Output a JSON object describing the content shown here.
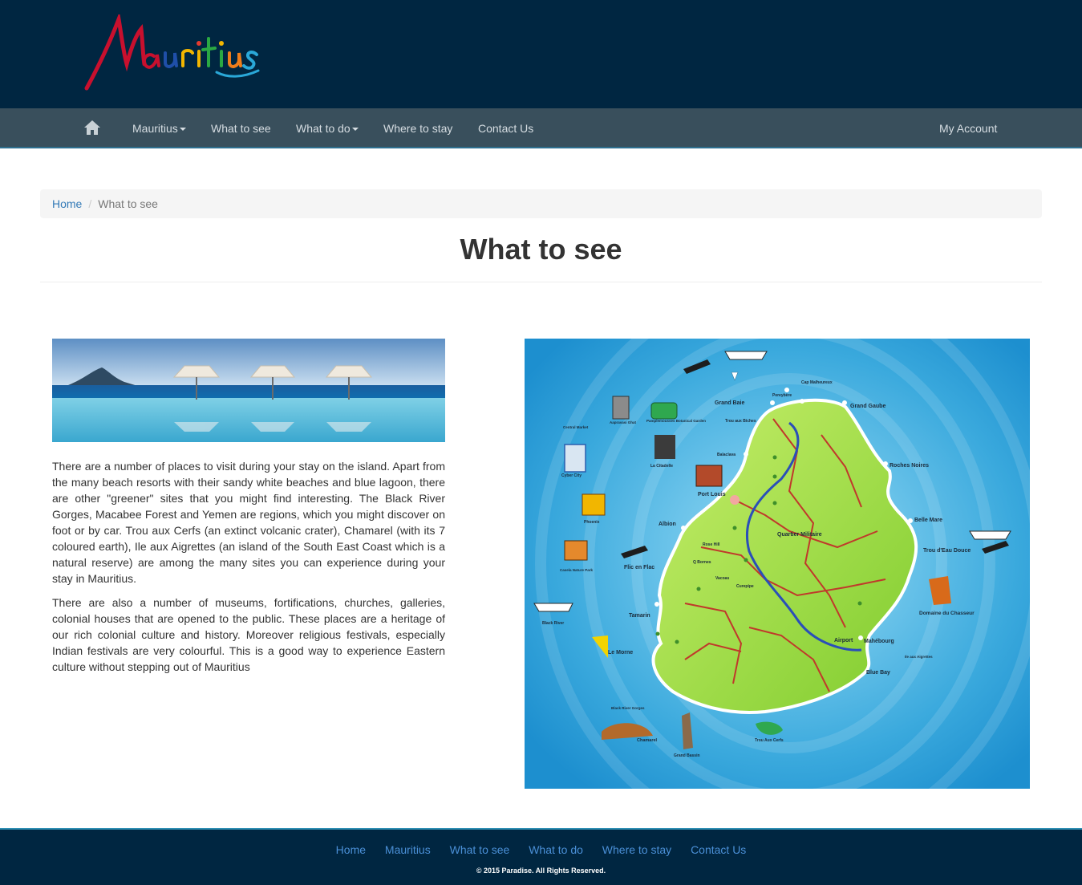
{
  "header": {
    "logo_text": "Mauritius"
  },
  "nav": {
    "home_icon": "home-icon",
    "items": [
      {
        "label": "Mauritius",
        "dropdown": true
      },
      {
        "label": "What to see",
        "dropdown": false
      },
      {
        "label": "What to do",
        "dropdown": true
      },
      {
        "label": "Where to stay",
        "dropdown": false
      },
      {
        "label": "Contact Us",
        "dropdown": false
      }
    ],
    "account": "My Account"
  },
  "breadcrumb": {
    "home": "Home",
    "separator": "/",
    "current": "What to see"
  },
  "page": {
    "title": "What to see",
    "paragraphs": [
      "There are a number of places to visit during your stay on the island. Apart from the many beach resorts with their sandy white beaches and blue lagoon, there are other \"greener\" sites that you might find interesting. The Black River Gorges, Macabee Forest and Yemen are regions, which you might discover on foot or by car. Trou aux Cerfs (an extinct volcanic crater), Chamarel (with its 7 coloured earth), Ile aux Aigrettes (an island of the South East Coast which is a natural reserve) are among the many sites you can experience during your stay in Mauritius.",
      "There are also a number of museums, fortifications, churches, galleries, colonial houses that are opened to the public. These places are a heritage of our rich colonial culture and history. Moreover religious festivals, especially Indian festivals are very colourful. This is a good way to experience Eastern culture without stepping out of Mauritius"
    ]
  },
  "map": {
    "labels": [
      {
        "text": "Cap Malheureux"
      },
      {
        "text": "Pereybère"
      },
      {
        "text": "Grand Baie"
      },
      {
        "text": "Grand Gaube"
      },
      {
        "text": "Trou aux Biches"
      },
      {
        "text": "Pamplemousses Botanical Garden"
      },
      {
        "text": "Aapravasi Ghat"
      },
      {
        "text": "Central Market"
      },
      {
        "text": "Balaclava"
      },
      {
        "text": "La Citadelle"
      },
      {
        "text": "Cyber City"
      },
      {
        "text": "Port Louis"
      },
      {
        "text": "Roches Noires"
      },
      {
        "text": "Phoenix"
      },
      {
        "text": "Albion"
      },
      {
        "text": "Belle Mare"
      },
      {
        "text": "Quartier Militaire"
      },
      {
        "text": "Rose Hill"
      },
      {
        "text": "Q Bornes"
      },
      {
        "text": "Trou d'Eau Douce"
      },
      {
        "text": "Casela Nature Park"
      },
      {
        "text": "Flic en Flac"
      },
      {
        "text": "Vacoas"
      },
      {
        "text": "Curepipe"
      },
      {
        "text": "Tamarin"
      },
      {
        "text": "Domaine du Chasseur"
      },
      {
        "text": "Black River"
      },
      {
        "text": "Airport"
      },
      {
        "text": "Mahébourg"
      },
      {
        "text": "Le Morne"
      },
      {
        "text": "Ile aux Aigrettes"
      },
      {
        "text": "Blue Bay"
      },
      {
        "text": "Black River Gorges"
      },
      {
        "text": "Chamarel"
      },
      {
        "text": "Grand Bassin"
      },
      {
        "text": "Trou Aux Cerfs"
      }
    ]
  },
  "footer": {
    "links": [
      "Home",
      "Mauritius",
      "What to see",
      "What to do",
      "Where to stay",
      "Contact Us"
    ],
    "copyright": "© 2015 Paradise. All Rights Reserved."
  },
  "colors": {
    "banner": "#002641",
    "navbar": "#394f5c",
    "link": "#337ab7",
    "footer_link": "#4a8fd6"
  }
}
